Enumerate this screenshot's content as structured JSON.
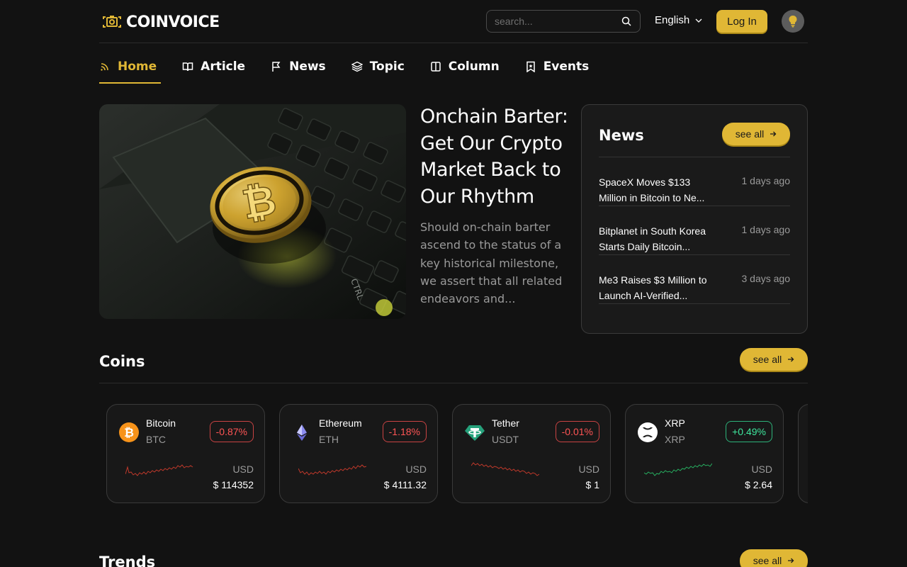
{
  "header": {
    "logo_text": "COINVOICE",
    "search_placeholder": "search...",
    "language": "English",
    "login_label": "Log In"
  },
  "nav": {
    "items": [
      {
        "label": "Home",
        "icon": "rss-icon",
        "active": true
      },
      {
        "label": "Article",
        "icon": "book-icon",
        "active": false
      },
      {
        "label": "News",
        "icon": "flag-icon",
        "active": false
      },
      {
        "label": "Topic",
        "icon": "layers-icon",
        "active": false
      },
      {
        "label": "Column",
        "icon": "columns-icon",
        "active": false
      },
      {
        "label": "Events",
        "icon": "bookmark-icon",
        "active": false
      }
    ]
  },
  "hero": {
    "title": "Onchain Barter: Get Our Crypto Market Back to Our Rhythm",
    "description": "Should on-chain barter ascend to the status of a key historical milestone, we assert that all related endeavors and..."
  },
  "news": {
    "title": "News",
    "see_all": "see all",
    "items": [
      {
        "headline": "SpaceX Moves $133 Million in Bitcoin to Ne...",
        "time": "1 days ago"
      },
      {
        "headline": "Bitplanet in South Korea Starts Daily Bitcoin...",
        "time": "1 days ago"
      },
      {
        "headline": "Me3 Raises $3 Million to Launch AI-Verified...",
        "time": "3 days ago"
      }
    ]
  },
  "coins": {
    "title": "Coins",
    "see_all": "see all",
    "items": [
      {
        "name": "Bitcoin",
        "symbol": "BTC",
        "change": "-0.87%",
        "trend": "neg",
        "currency": "USD",
        "price": "$ 114352",
        "icon": "bitcoin-icon",
        "color": "#f7931a"
      },
      {
        "name": "Ethereum",
        "symbol": "ETH",
        "change": "-1.18%",
        "trend": "neg",
        "currency": "USD",
        "price": "$ 4111.32",
        "icon": "ethereum-icon",
        "color": "#8c8cf0"
      },
      {
        "name": "Tether",
        "symbol": "USDT",
        "change": "-0.01%",
        "trend": "neg",
        "currency": "USD",
        "price": "$ 1",
        "icon": "tether-icon",
        "color": "#26a17b"
      },
      {
        "name": "XRP",
        "symbol": "XRP",
        "change": "+0.49%",
        "trend": "pos",
        "currency": "USD",
        "price": "$ 2.64",
        "icon": "xrp-icon",
        "color": "#ffffff"
      }
    ]
  },
  "trends": {
    "title": "Trends",
    "see_all": "see all"
  },
  "colors": {
    "accent": "#e0b735",
    "background": "#121212",
    "negative": "#ff5555",
    "positive": "#3ee69d"
  }
}
